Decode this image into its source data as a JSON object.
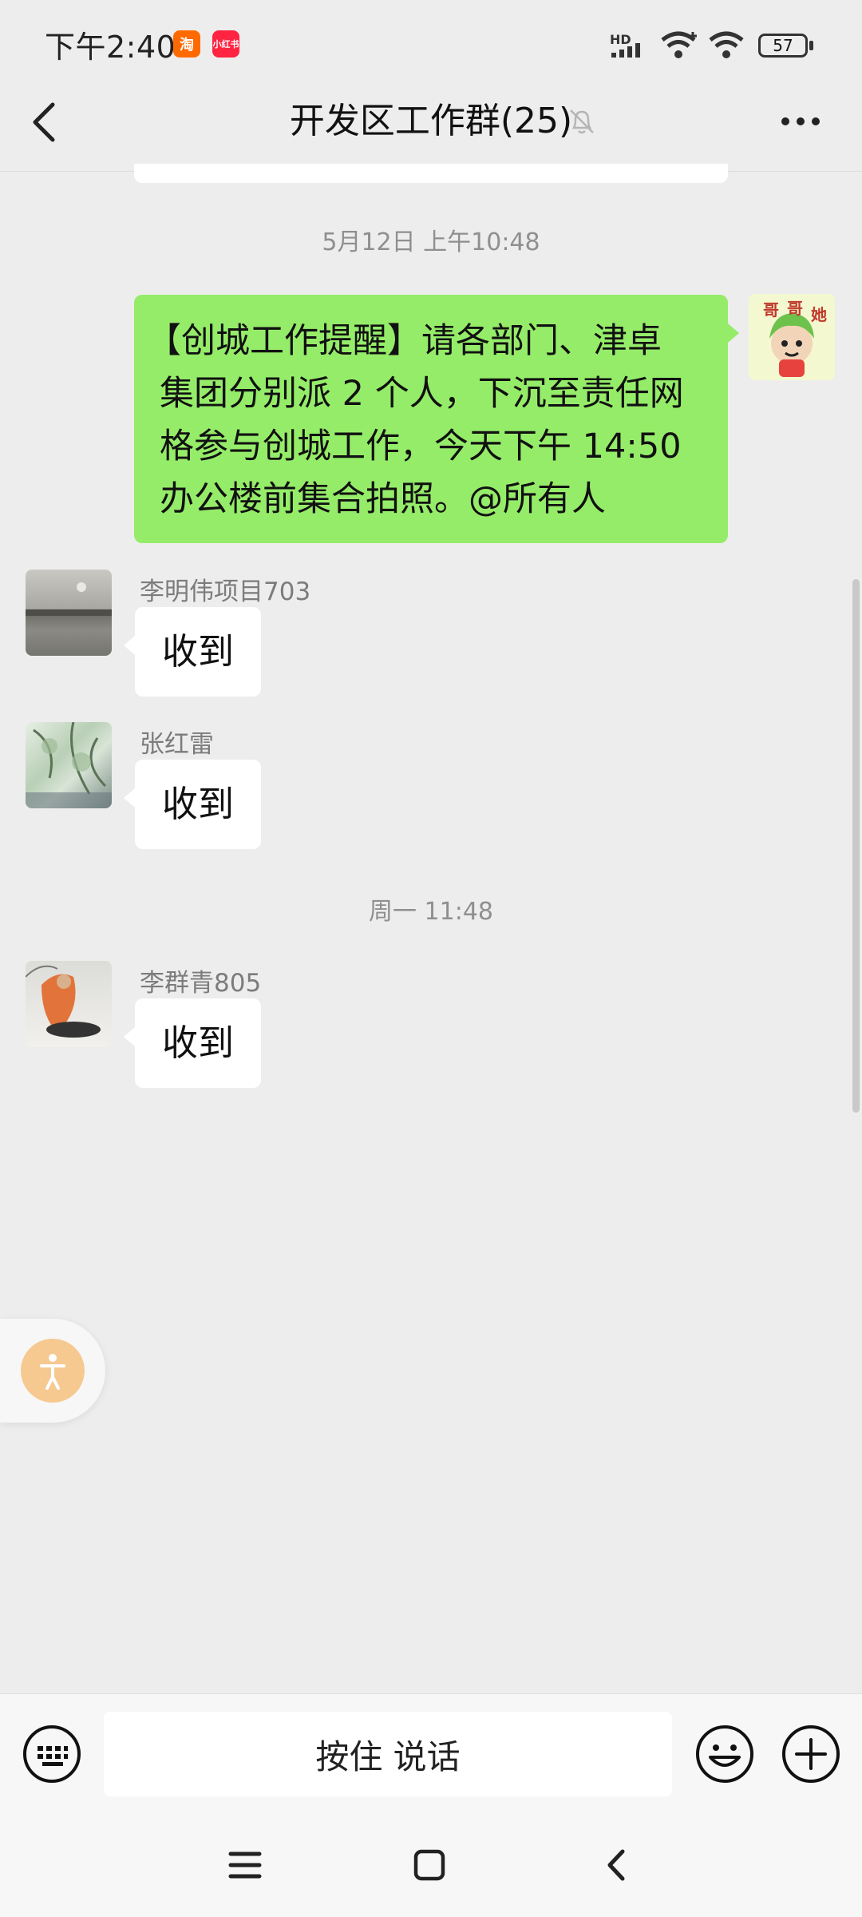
{
  "status_bar": {
    "time": "下午2:40",
    "app_badges": [
      {
        "name": "taobao",
        "label": "淘",
        "color": "#ff6a00"
      },
      {
        "name": "xiaohongshu",
        "label": "小红书",
        "color": "#ff2442"
      }
    ],
    "network_label": "HD",
    "battery": "57"
  },
  "header": {
    "title": "开发区工作群(25)",
    "muted": true
  },
  "messages": [
    {
      "type": "timestamp",
      "text": "5月12日 上午10:48"
    },
    {
      "type": "outgoing",
      "lines": [
        "【创城工作提醒】请各部门、津卓",
        "集团分别派 2 个人，下沉至责任网",
        "格参与创城工作，今天下午 14:50",
        "办公楼前集合拍照。@所有人"
      ],
      "avatar_text": [
        "哥",
        "哥",
        "她"
      ]
    },
    {
      "type": "incoming",
      "sender": "李明伟项目703",
      "text": "收到"
    },
    {
      "type": "incoming",
      "sender": "张红雷",
      "text": "收到"
    },
    {
      "type": "timestamp",
      "text": "周一 11:48"
    },
    {
      "type": "incoming",
      "sender": "李群青805",
      "text": "收到"
    }
  ],
  "input_bar": {
    "voice_label": "按住 说话"
  },
  "colors": {
    "background": "#ededed",
    "outgoing_bubble": "#95ec69",
    "incoming_bubble": "#ffffff",
    "accessibility_button": "#f6c990"
  },
  "icons": {
    "back": "back-arrow-icon",
    "mute": "bell-off-icon",
    "more": "more-dots-icon",
    "keyboard": "keyboard-icon",
    "emoji": "emoji-icon",
    "add": "plus-circle-icon",
    "accessibility": "accessibility-icon",
    "nav_menu": "menu-icon",
    "nav_home": "home-square-icon",
    "nav_back": "nav-back-icon"
  }
}
